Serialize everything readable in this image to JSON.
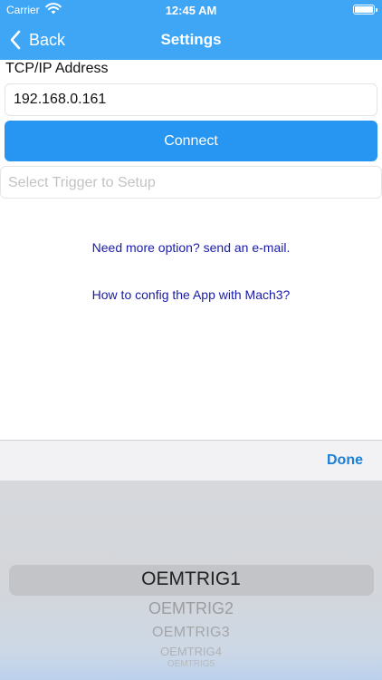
{
  "status_bar": {
    "carrier": "Carrier",
    "time": "12:45 AM"
  },
  "nav": {
    "back_label": "Back",
    "title": "Settings"
  },
  "form": {
    "ip_label": "TCP/IP Address",
    "ip_value": "192.168.0.161",
    "connect_label": "Connect",
    "trigger_placeholder": "Select Trigger to Setup"
  },
  "links": {
    "email": "Need more option? send an e-mail.",
    "help": "How to config the App with Mach3?"
  },
  "picker": {
    "done_label": "Done",
    "options": [
      "OEMTRIG1",
      "OEMTRIG2",
      "OEMTRIG3",
      "OEMTRIG4",
      "OEMTRIG5"
    ],
    "selected": "OEMTRIG1"
  },
  "colors": {
    "nav_bg": "#3ea6f5",
    "button_bg": "#2796f3",
    "link": "#1a1aaa",
    "done": "#1a7fd8"
  }
}
